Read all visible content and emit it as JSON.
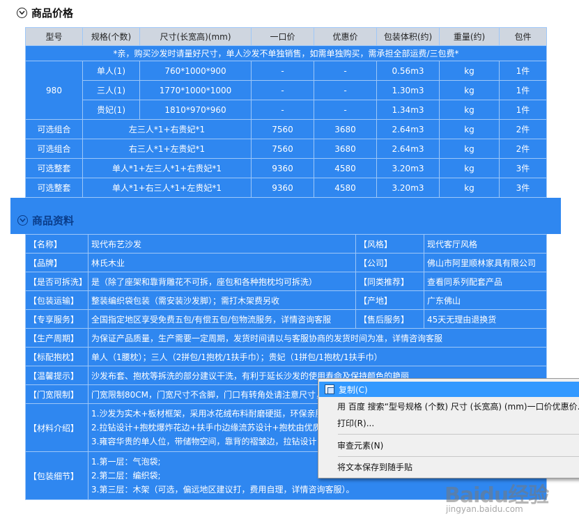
{
  "price_section": {
    "title": "商品价格",
    "headers": [
      "型号",
      "规格(个数)",
      "尺寸(长宽高)(mm)",
      "一口价",
      "优惠价",
      "包装体积(约)",
      "重量(约)",
      "包件"
    ],
    "note": "*亲，购买沙发时请量好尺寸，单人沙发不单独销售，如需单独购买，需承担全部运费/三包费*",
    "model": "980",
    "model_rows": [
      {
        "spec": "单人(1)",
        "size": "760*1000*900",
        "price": "-",
        "discount": "-",
        "volume": "0.56m3",
        "weight": "kg",
        "pieces": "1件"
      },
      {
        "spec": "三人(1)",
        "size": "1770*1000*1000",
        "price": "-",
        "discount": "-",
        "volume": "1.30m3",
        "weight": "kg",
        "pieces": "1件"
      },
      {
        "spec": "贵妃(1)",
        "size": "1810*970*960",
        "price": "-",
        "discount": "-",
        "volume": "1.34m3",
        "weight": "kg",
        "pieces": "1件"
      }
    ],
    "combo_rows": [
      {
        "type": "可选组合",
        "desc": "左三人*1+右贵妃*1",
        "price": "7560",
        "discount": "3680",
        "volume": "2.64m3",
        "weight": "kg",
        "pieces": "2件"
      },
      {
        "type": "可选组合",
        "desc": "右三人*1+左贵妃*1",
        "price": "7560",
        "discount": "3680",
        "volume": "2.64m3",
        "weight": "kg",
        "pieces": "2件"
      },
      {
        "type": "可选整套",
        "desc": "单人*1+左三人*1+右贵妃*1",
        "price": "9360",
        "discount": "4580",
        "volume": "3.20m3",
        "weight": "kg",
        "pieces": "3件"
      },
      {
        "type": "可选整套",
        "desc": "单人*1+右三人*1+左贵妃*1",
        "price": "9360",
        "discount": "4580",
        "volume": "3.20m3",
        "weight": "kg",
        "pieces": "3件"
      }
    ]
  },
  "info_section": {
    "title": "商品资料",
    "pair_rows": [
      {
        "k1": "【名称】",
        "v1": "现代布艺沙发",
        "k2": "【风格】",
        "v2": "现代客厅风格"
      },
      {
        "k1": "【品牌】",
        "v1": "林氏木业",
        "k2": "【公司】",
        "v2": "佛山市阿里顺林家具有限公司"
      },
      {
        "k1": "【是否可拆洗】",
        "v1": "是（除了座架和靠背雕花不可拆，座包和各种抱枕均可拆洗）",
        "k2": "【同类推荐】",
        "v2": "查看同系列配套产品"
      },
      {
        "k1": "【包装运输】",
        "v1": "整装编织袋包装（需安装沙发脚）；需打木架费另收",
        "k2": "【产地】",
        "v2": "广东佛山"
      },
      {
        "k1": "【专享服务】",
        "v1": "全国指定地区享受免费五包/有偿五包/包物流服务，详情咨询客服",
        "k2": "【售后服务】",
        "v2": "45天无理由退换货"
      }
    ],
    "full_rows": [
      {
        "k": "【生产周期】",
        "v": "为保证产品质量，生产需要一定周期，发货时间请以与客服协商的发货时间为准，详情咨询客服"
      },
      {
        "k": "【标配抱枕】",
        "v": "单人（1腰枕）；三人（2拼包/1抱枕/1扶手巾）；贵妃（1拼包/1抱枕/1扶手巾）"
      },
      {
        "k": "【温馨提示】",
        "v": "沙发布套、抱枕等拆洗的部分建议干洗，有利于延长沙发的使用寿命及保持颜色的艳丽"
      },
      {
        "k": "【门宽限制】",
        "v": "门宽限制80CM，门宽尺寸不含脚，门口有转角处请注意尺寸，"
      }
    ],
    "material": {
      "k": "【材料介绍】",
      "lines": [
        "1.沙发为实木+板材框架，采用冰花绒布料耐磨硬挺，环保亲肤",
        "2.拉钻设计+抱枕爆炸花边+扶手巾边缘流苏设计+抱枕由优质人",
        "3.雍容华贵的单人位，带储物空间，靠背的褶皱边，拉钻设计"
      ]
    },
    "packaging": {
      "k": "【包装细节】",
      "lines": [
        "1.第一层：气泡袋;",
        "2.第二层：编织袋;",
        "3.第三层：木架（可选，偏远地区建议打，费用自理，详情咨询客服）。"
      ]
    }
  },
  "context_menu": {
    "items": [
      {
        "label": "复制(C)"
      },
      {
        "label": "用 百度 搜索“型号规格 (个数) 尺寸 (长宽高) (mm)一口价优惠价..."
      },
      {
        "label": "打印(R)..."
      },
      {
        "label": "审查元素(N)"
      },
      {
        "label": "将文本保存到随手贴"
      }
    ]
  },
  "watermark": {
    "logo": "Baidu经验",
    "url": "jingyan.baidu.com"
  },
  "colors": {
    "table_blue": "#2f87f0",
    "header_gray": "#cfd6e0",
    "menu_highlight": "#3399ff"
  }
}
